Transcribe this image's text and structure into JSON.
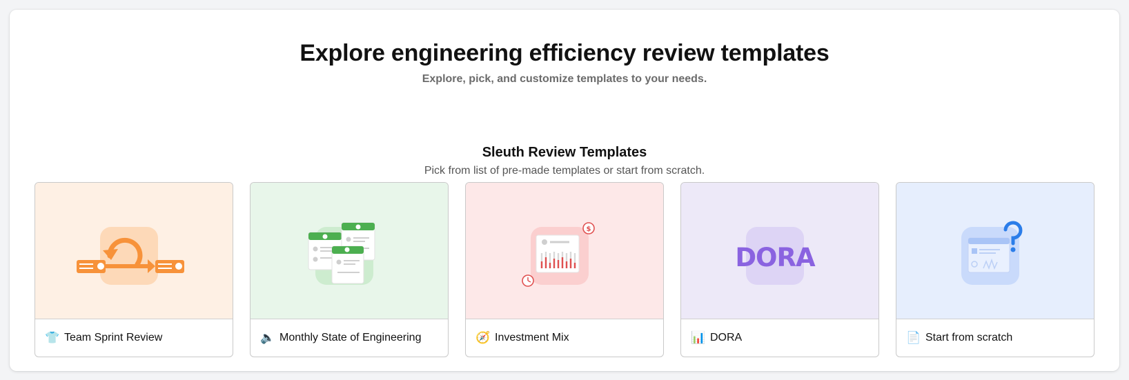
{
  "header": {
    "title": "Explore engineering efficiency review templates",
    "subtitle": "Explore, pick, and customize templates to your needs."
  },
  "section": {
    "title": "Sleuth Review Templates",
    "subtitle": "Pick from list of pre-made templates or start from scratch."
  },
  "templates": [
    {
      "label": "Team Sprint Review",
      "emoji": "👕",
      "icon": "sprint-cycle-icon",
      "bg": "#fef0e4"
    },
    {
      "label": "Monthly State of Engineering",
      "emoji": "🔈",
      "icon": "report-cards-icon",
      "bg": "#e8f6ea"
    },
    {
      "label": "Investment Mix",
      "emoji": "🧭",
      "icon": "investment-chart-icon",
      "bg": "#fde8e8"
    },
    {
      "label": "DORA",
      "emoji": "📊",
      "icon": "dora-text-icon",
      "art_text": "DORA",
      "bg": "#ede9f8"
    },
    {
      "label": "Start from scratch",
      "emoji": "📄",
      "icon": "question-window-icon",
      "bg": "#e6eefd"
    }
  ],
  "colors": {
    "orange": "#f7923a",
    "green": "#4caf50",
    "red": "#e05050",
    "purple": "#8a63e0",
    "blue": "#2b7de9"
  }
}
